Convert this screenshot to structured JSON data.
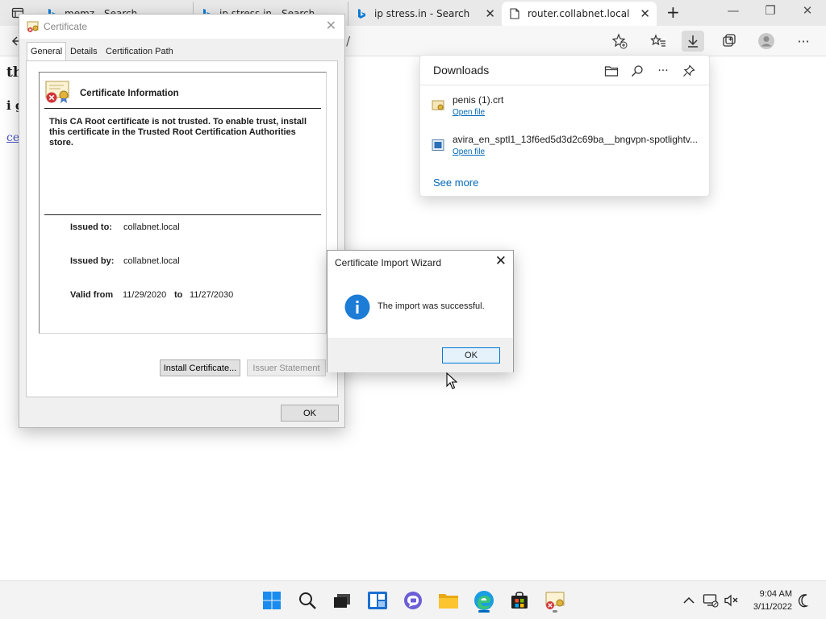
{
  "browser": {
    "tabs": [
      {
        "label": "memz - Search"
      },
      {
        "label": "ip stress.in - Search"
      },
      {
        "label": "ip stress.in - Search"
      },
      {
        "label": "router.collabnet.local"
      }
    ],
    "new_tab_symbol": "+",
    "address_tail": "l/"
  },
  "page": {
    "line1": "th",
    "line2": "i g",
    "link": "ce"
  },
  "downloads": {
    "title": "Downloads",
    "items": [
      {
        "name": "penis (1).crt",
        "action": "Open file",
        "icon": "certificate-file-icon"
      },
      {
        "name": "avira_en_sptl1_13f6ed5d3d2c69ba__bngvpn-spotlightv...",
        "action": "Open file",
        "icon": "installer-file-icon"
      }
    ],
    "see_more": "See more",
    "header_icons": [
      "folder-icon",
      "search-icon",
      "more-icon",
      "pin-icon"
    ]
  },
  "certificate": {
    "window_title": "Certificate",
    "tabs": [
      "General",
      "Details",
      "Certification Path"
    ],
    "selected_tab": "General",
    "info_title": "Certificate Information",
    "warning": "This CA Root certificate is not trusted. To enable trust, install this certificate in the Trusted Root Certification Authorities store.",
    "issued_to_label": "Issued to:",
    "issued_to": "collabnet.local",
    "issued_by_label": "Issued by:",
    "issued_by": "collabnet.local",
    "valid_from_label": "Valid from",
    "valid_from": "11/29/2020",
    "valid_to_label": "to",
    "valid_to": "11/27/2030",
    "install_button": "Install Certificate...",
    "issuer_button": "Issuer Statement",
    "ok_button": "OK"
  },
  "wizard": {
    "title": "Certificate Import Wizard",
    "message": "The import was successful.",
    "ok_button": "OK"
  },
  "taskbar": {
    "apps": [
      "start-icon",
      "search-icon",
      "task-view-icon",
      "widgets-icon",
      "chat-icon",
      "file-explorer-icon",
      "edge-icon",
      "store-icon",
      "certificate-app-icon"
    ],
    "active_app": "edge-icon",
    "time": "9:04 AM",
    "date": "3/11/2022"
  },
  "colors": {
    "accent": "#0067c0",
    "link": "#0067b8",
    "info_blue": "#1c7cd6",
    "error_red": "#d13438"
  }
}
